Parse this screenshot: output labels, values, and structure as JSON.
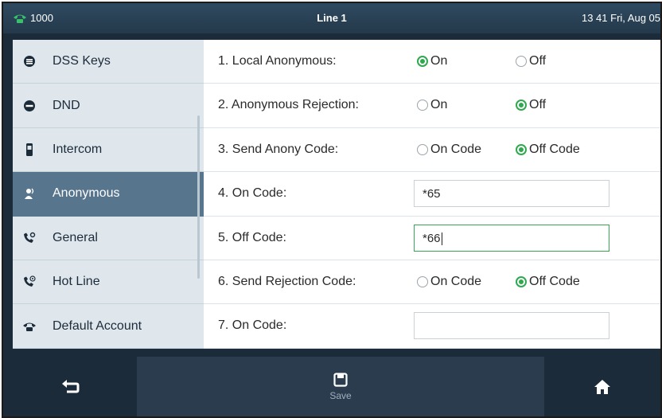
{
  "topbar": {
    "account": "1000",
    "title": "Line 1",
    "clock": "13 41 Fri, Aug 05"
  },
  "sidebar": {
    "items": [
      {
        "label": "DSS Keys",
        "icon": "dss-keys-icon"
      },
      {
        "label": "DND",
        "icon": "dnd-icon"
      },
      {
        "label": "Intercom",
        "icon": "intercom-icon"
      },
      {
        "label": "Anonymous",
        "icon": "anonymous-icon",
        "active": true
      },
      {
        "label": "General",
        "icon": "general-icon"
      },
      {
        "label": "Hot Line",
        "icon": "hot-line-icon"
      },
      {
        "label": "Default Account",
        "icon": "phone-icon"
      }
    ]
  },
  "settings": {
    "local_anonymous": {
      "label": "1. Local Anonymous:",
      "opt1": "On",
      "opt2": "Off",
      "selected": "On"
    },
    "anonymous_rejection": {
      "label": "2. Anonymous Rejection:",
      "opt1": "On",
      "opt2": "Off",
      "selected": "Off"
    },
    "send_anony_code": {
      "label": "3. Send Anony Code:",
      "opt1": "On Code",
      "opt2": "Off Code",
      "selected": "Off Code"
    },
    "on_code": {
      "label": "4. On Code:",
      "value": "*65"
    },
    "off_code": {
      "label": "5. Off Code:",
      "value": "*66"
    },
    "send_rejection_code": {
      "label": "6. Send Rejection Code:",
      "opt1": "On Code",
      "opt2": "Off Code",
      "selected": "Off Code"
    },
    "rejection_on_code": {
      "label": "7. On Code:",
      "value": ""
    }
  },
  "softkeys": {
    "back_icon": "back-arrow-icon",
    "save_label": "Save",
    "save_icon": "save-icon",
    "home_icon": "home-icon"
  },
  "colors": {
    "accent_green": "#2fa84f",
    "active_item": "#58758e",
    "bar": "#1c2b3a"
  }
}
